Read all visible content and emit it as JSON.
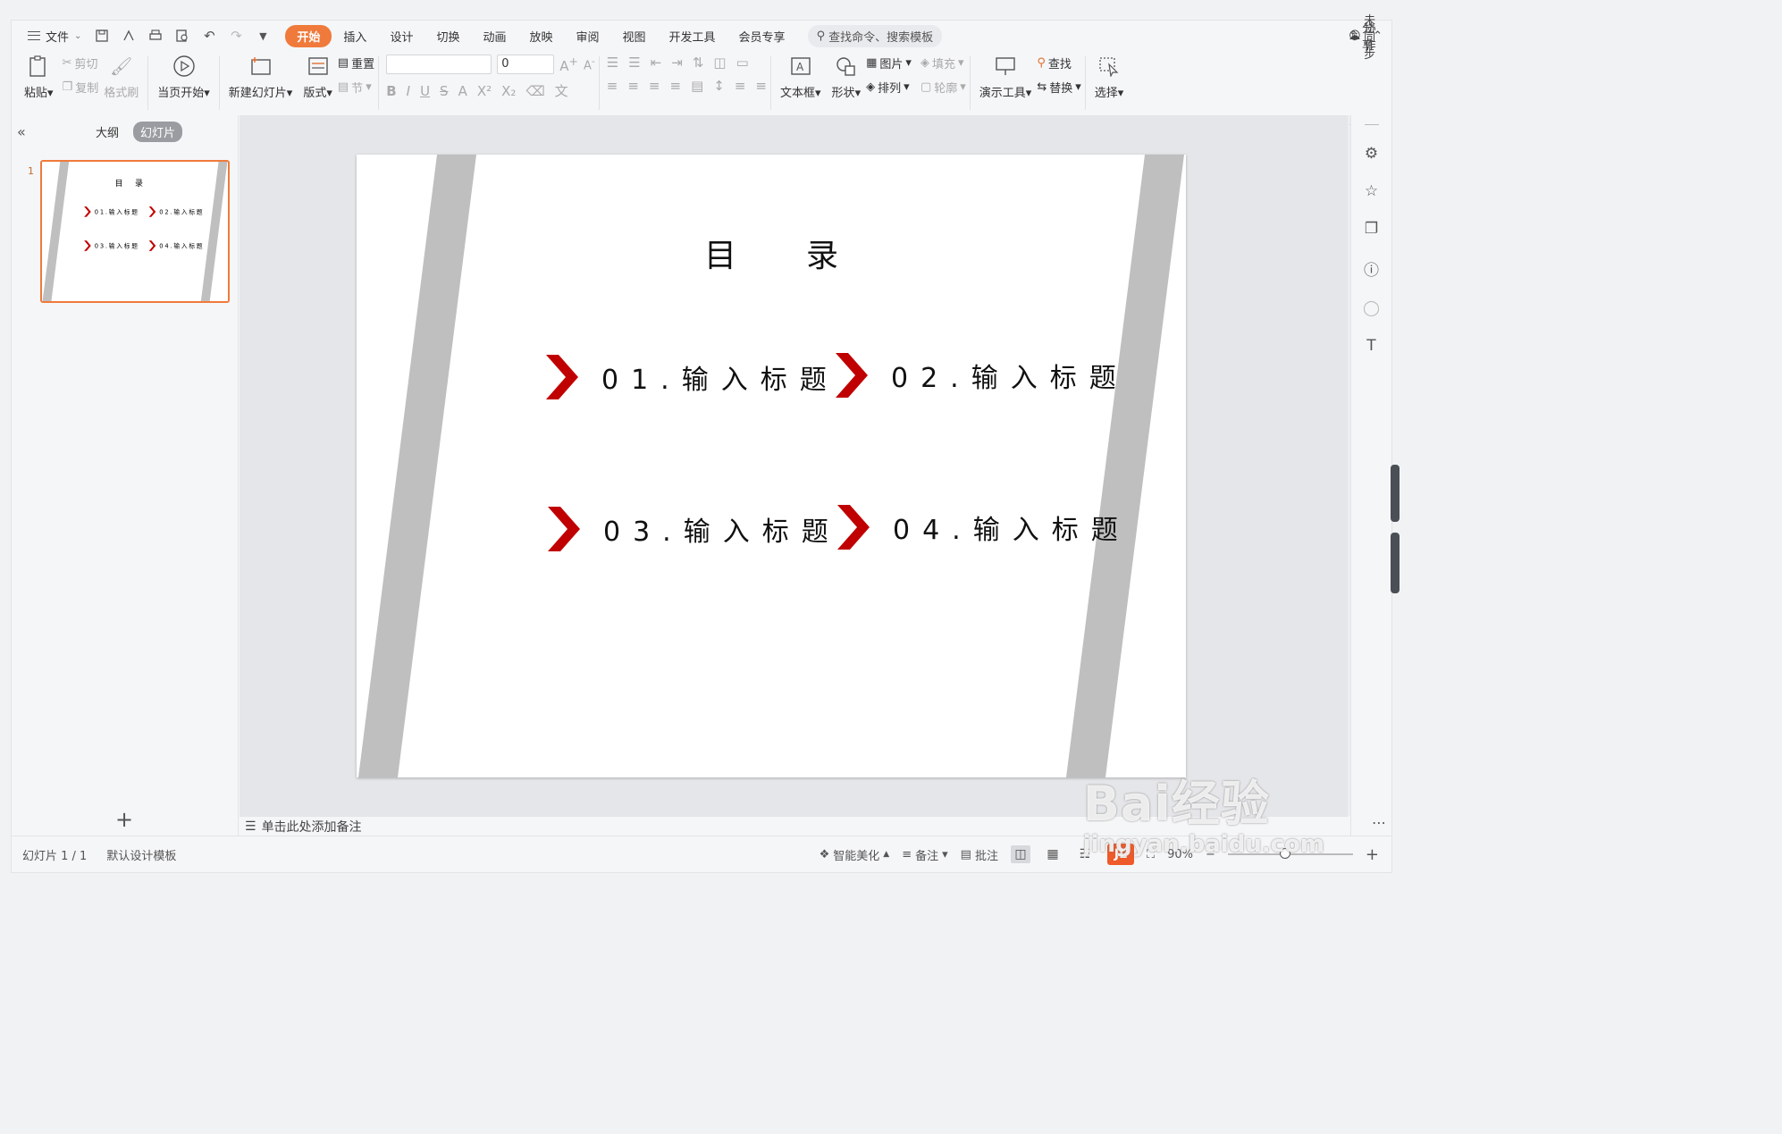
{
  "menubar": {
    "file_label": "文件",
    "tabs": [
      "开始",
      "插入",
      "设计",
      "切换",
      "动画",
      "放映",
      "审阅",
      "视图",
      "开发工具",
      "会员专享"
    ],
    "active_tab": "开始",
    "search_placeholder": "查找命令、搜索模板",
    "sync_label": "未同步",
    "collab_label": "协作",
    "share_label": "分享"
  },
  "ribbon": {
    "paste": "粘贴",
    "cut": "剪切",
    "copy": "复制",
    "format_painter": "格式刷",
    "from_current": "当页开始",
    "new_slide": "新建幻灯片",
    "layout": "版式",
    "reset": "重置",
    "section": "节",
    "font_size_value": "0",
    "text_box": "文本框",
    "shape": "形状",
    "picture": "图片",
    "arrange": "排列",
    "fill": "填充",
    "outline": "轮廓",
    "presenter_tools": "演示工具",
    "find": "查找",
    "replace": "替换",
    "select": "选择"
  },
  "left_panel": {
    "outline_tab": "大纲",
    "slides_tab": "幻灯片",
    "slide_number": "1"
  },
  "slide": {
    "title": "目录",
    "items": [
      "01.输入标题",
      "02.输入标题",
      "03.输入标题",
      "04.输入标题"
    ],
    "accent_color": "#c00000",
    "band_color": "#bfbfbf"
  },
  "notes": {
    "placeholder": "单击此处添加备注"
  },
  "statusbar": {
    "slide_info": "幻灯片 1 / 1",
    "template": "默认设计模板",
    "smart_beautify": "智能美化",
    "notes": "备注",
    "comments": "批注",
    "zoom": "90%"
  },
  "watermark": {
    "line1": "Bai经验",
    "line2": "jingyan.baidu.com"
  }
}
